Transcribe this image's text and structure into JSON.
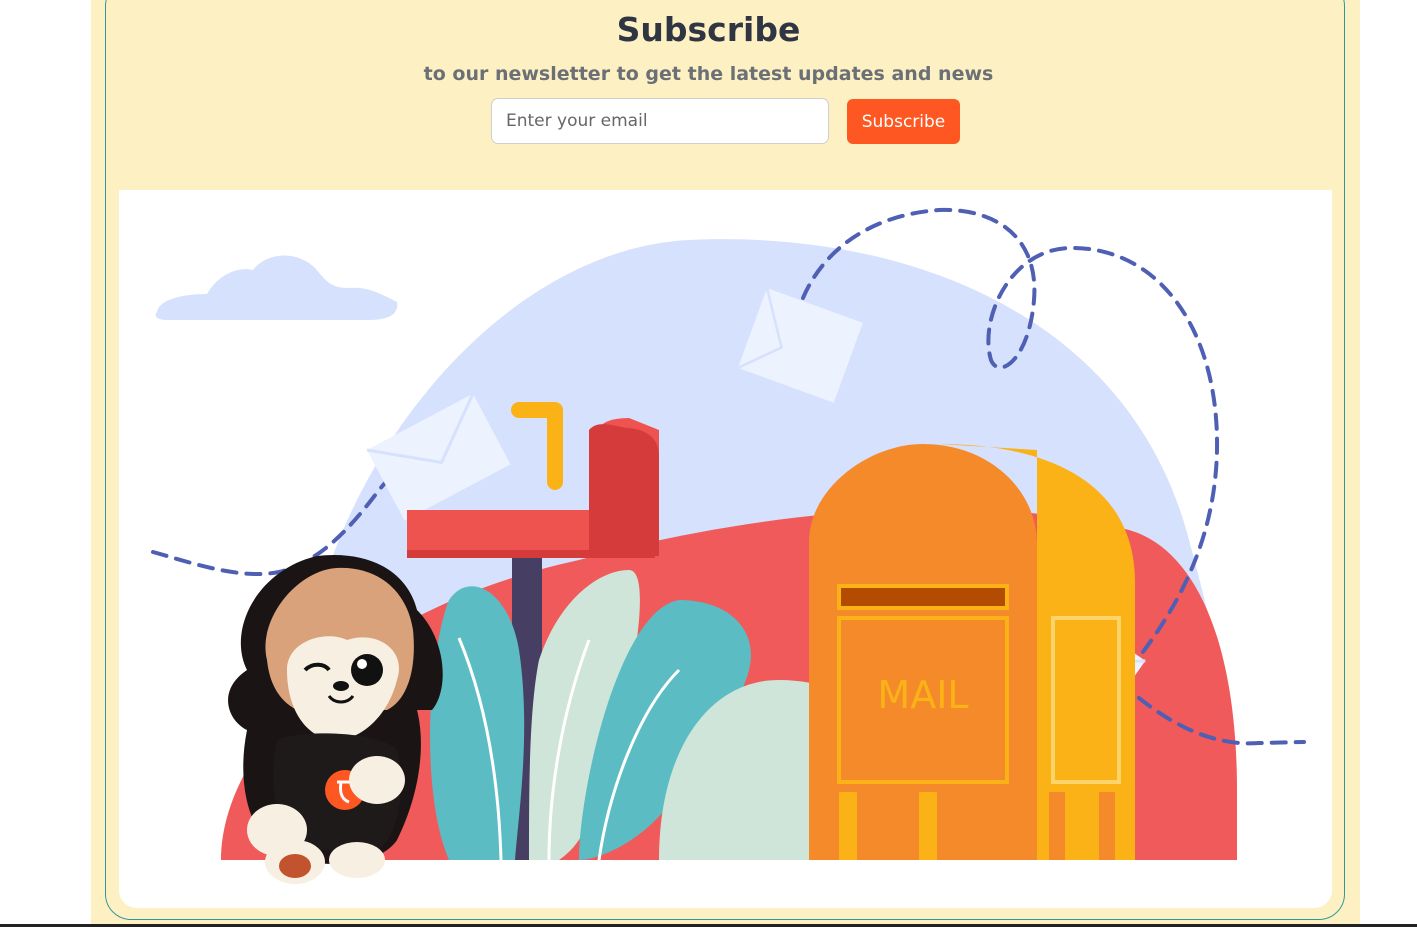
{
  "newsletter": {
    "title": "Subscribe",
    "subtitle": "to our newsletter to get the latest updates and news",
    "email_placeholder": "Enter your email",
    "email_value": "",
    "button_label": "Subscribe"
  },
  "illustration": {
    "mailbox_label": "MAIL",
    "colors": {
      "background_blob": "#d6e1fd",
      "red_hill": "#f05a5a",
      "mailbox_orange": "#f58a2a",
      "mailbox_yellow": "#fbb217",
      "mailbox_red": "#ef5350",
      "leaf_teal": "#5cbcc4",
      "leaf_light": "#cfe5da",
      "dashed_path": "#4f5fb3",
      "accent_button": "#ff5722",
      "section_bg": "#fdf1c3"
    }
  }
}
